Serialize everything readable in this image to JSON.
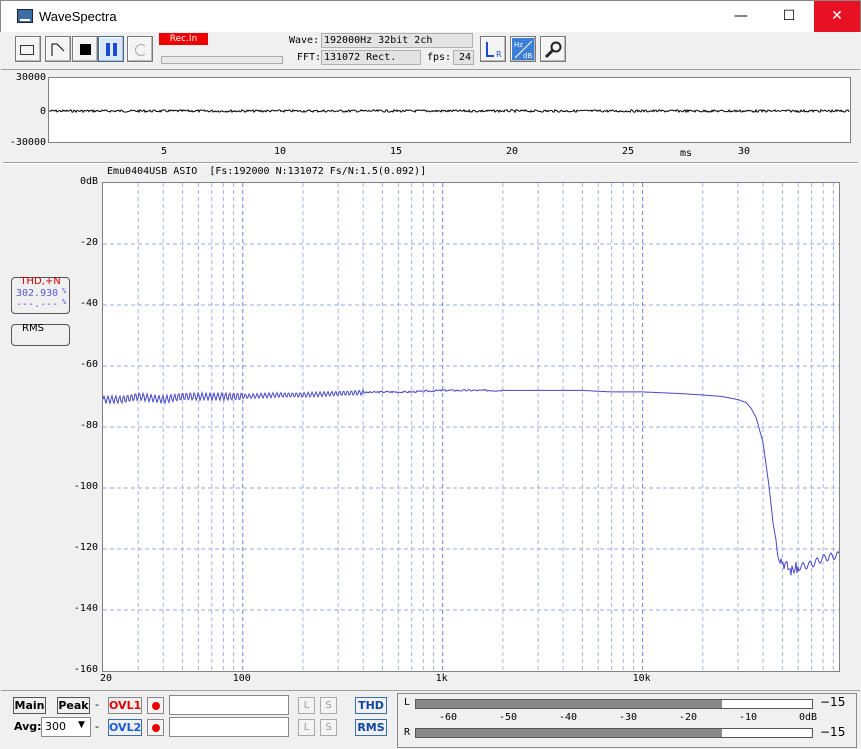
{
  "window": {
    "title": "WaveSpectra",
    "min_glyph": "—",
    "max_glyph": "☐",
    "close_glyph": "✕"
  },
  "toolbar": {
    "rec_indicator": "Rec.In",
    "wave_label": "Wave:",
    "wave_value": "192000Hz 32bit 2ch",
    "fft_label": "FFT:",
    "fft_value": "131072 Rect.",
    "fps_label": "fps:",
    "fps_value": "24",
    "rec_level": 0,
    "icons": [
      "open-file-icon",
      "generate-icon",
      "stop-icon",
      "pause-icon",
      "loop-icon",
      "channel-lr-icon",
      "hz-db-icon",
      "settings-wrench-icon"
    ]
  },
  "wave": {
    "y_ticks": [
      "30000",
      "0",
      "-30000"
    ],
    "x_ticks": [
      "5",
      "10",
      "15",
      "20",
      "25",
      "30"
    ],
    "x_unit": "ms"
  },
  "spectrum": {
    "header": "Emu0404USB ASIO  [Fs:192000 N:131072 Fs/N:1.5(0.092)]",
    "y_ticks": [
      "0dB",
      "-20",
      "-40",
      "-60",
      "-80",
      "-100",
      "-120",
      "-140",
      "-160"
    ],
    "x_ticks": [
      "20",
      "100",
      "1k",
      "10k"
    ]
  },
  "side": {
    "thd_label": "THD,+N",
    "thd_value": "302.930",
    "thd_unit": "%",
    "thd_sub": "---.---",
    "thd_sub_unit": "%",
    "rms_label": "RMS"
  },
  "bottom": {
    "main": "Main",
    "peak": "Peak",
    "dash1": "-",
    "dash2": "-",
    "ovl1": "OVL1",
    "ovl2": "OVL2",
    "avg_label": "Avg:",
    "avg_value": "300",
    "l_btn": "L",
    "s_btn": "S",
    "thd_btn": "THD",
    "rms_btn": "RMS",
    "meter_l": "L",
    "meter_r": "R",
    "meter_ticks": [
      "-60",
      "-50",
      "-40",
      "-30",
      "-20",
      "-10",
      "0dB"
    ],
    "meter_l_value": "−15",
    "meter_r_value": "−15",
    "level_l_db": -15,
    "level_r_db": -15
  },
  "chart_data": {
    "type": "line",
    "x_scale": "log",
    "xlim": [
      20,
      96000
    ],
    "ylim": [
      -160,
      0
    ],
    "grid": true,
    "series": [
      {
        "x": [
          20,
          25,
          30,
          40,
          50,
          70,
          100,
          150,
          200,
          300,
          500,
          700,
          1000,
          2000,
          3000,
          5000,
          7000,
          10000,
          15000,
          20000,
          25000,
          30000,
          33000,
          35000,
          37000,
          40000,
          43000,
          45000,
          48000,
          50000,
          55000,
          60000,
          70000,
          80000,
          96000
        ],
        "y": [
          -71,
          -71,
          -70,
          -71,
          -70,
          -70,
          -70,
          -69.5,
          -69.5,
          -69,
          -68.5,
          -68.5,
          -68,
          -68,
          -68,
          -68,
          -68.5,
          -68.5,
          -69,
          -69.5,
          -70,
          -71,
          -72,
          -74,
          -77,
          -85,
          -100,
          -112,
          -122,
          -124,
          -127,
          -126,
          -125,
          -123,
          -122
        ]
      }
    ]
  }
}
